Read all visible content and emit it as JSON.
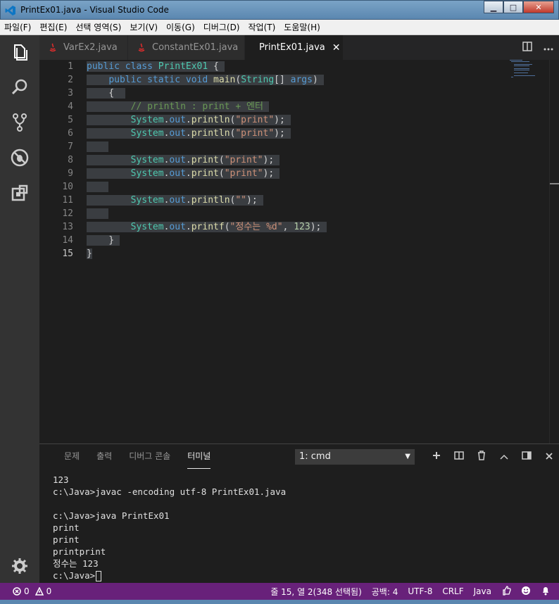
{
  "window": {
    "title": "PrintEx01.java - Visual Studio Code",
    "minimize": "▁",
    "maximize": "□",
    "close": "✕"
  },
  "menu": [
    "파일(F)",
    "편집(E)",
    "선택 영역(S)",
    "보기(V)",
    "이동(G)",
    "디버그(D)",
    "작업(T)",
    "도움말(H)"
  ],
  "activity_icons": [
    "explorer-icon",
    "search-icon",
    "source-control-icon",
    "debug-icon",
    "extensions-icon",
    "gear-icon"
  ],
  "tabs": [
    {
      "label": "VarEx2.java",
      "active": false
    },
    {
      "label": "ConstantEx01.java",
      "active": false
    },
    {
      "label": "PrintEx01.java",
      "active": true,
      "close": "✕"
    }
  ],
  "editor": {
    "line_numbers": [
      "1",
      "2",
      "3",
      "4",
      "5",
      "6",
      "7",
      "8",
      "9",
      "10",
      "11",
      "12",
      "13",
      "14",
      "15"
    ],
    "current_line": "15"
  },
  "panel": {
    "tabs": [
      "문제",
      "출력",
      "디버그 콘솔",
      "터미널"
    ],
    "active_tab": "터미널",
    "terminal_select": "1: cmd",
    "terminal_lines": [
      "123",
      "c:\\Java>javac -encoding utf-8 PrintEx01.java",
      "",
      "c:\\Java>java PrintEx01",
      "print",
      "print",
      "printprint",
      "정수는 123",
      "c:\\Java>"
    ]
  },
  "status": {
    "errors": "0",
    "warnings": "0",
    "position": "줄 15, 열 2(348 선택됨)",
    "indent": "공백: 4",
    "encoding": "UTF-8",
    "eol": "CRLF",
    "language": "Java"
  },
  "colors": {
    "statusbar": "#68217a",
    "editor_bg": "#1e1e1e",
    "activitybar": "#333333"
  }
}
